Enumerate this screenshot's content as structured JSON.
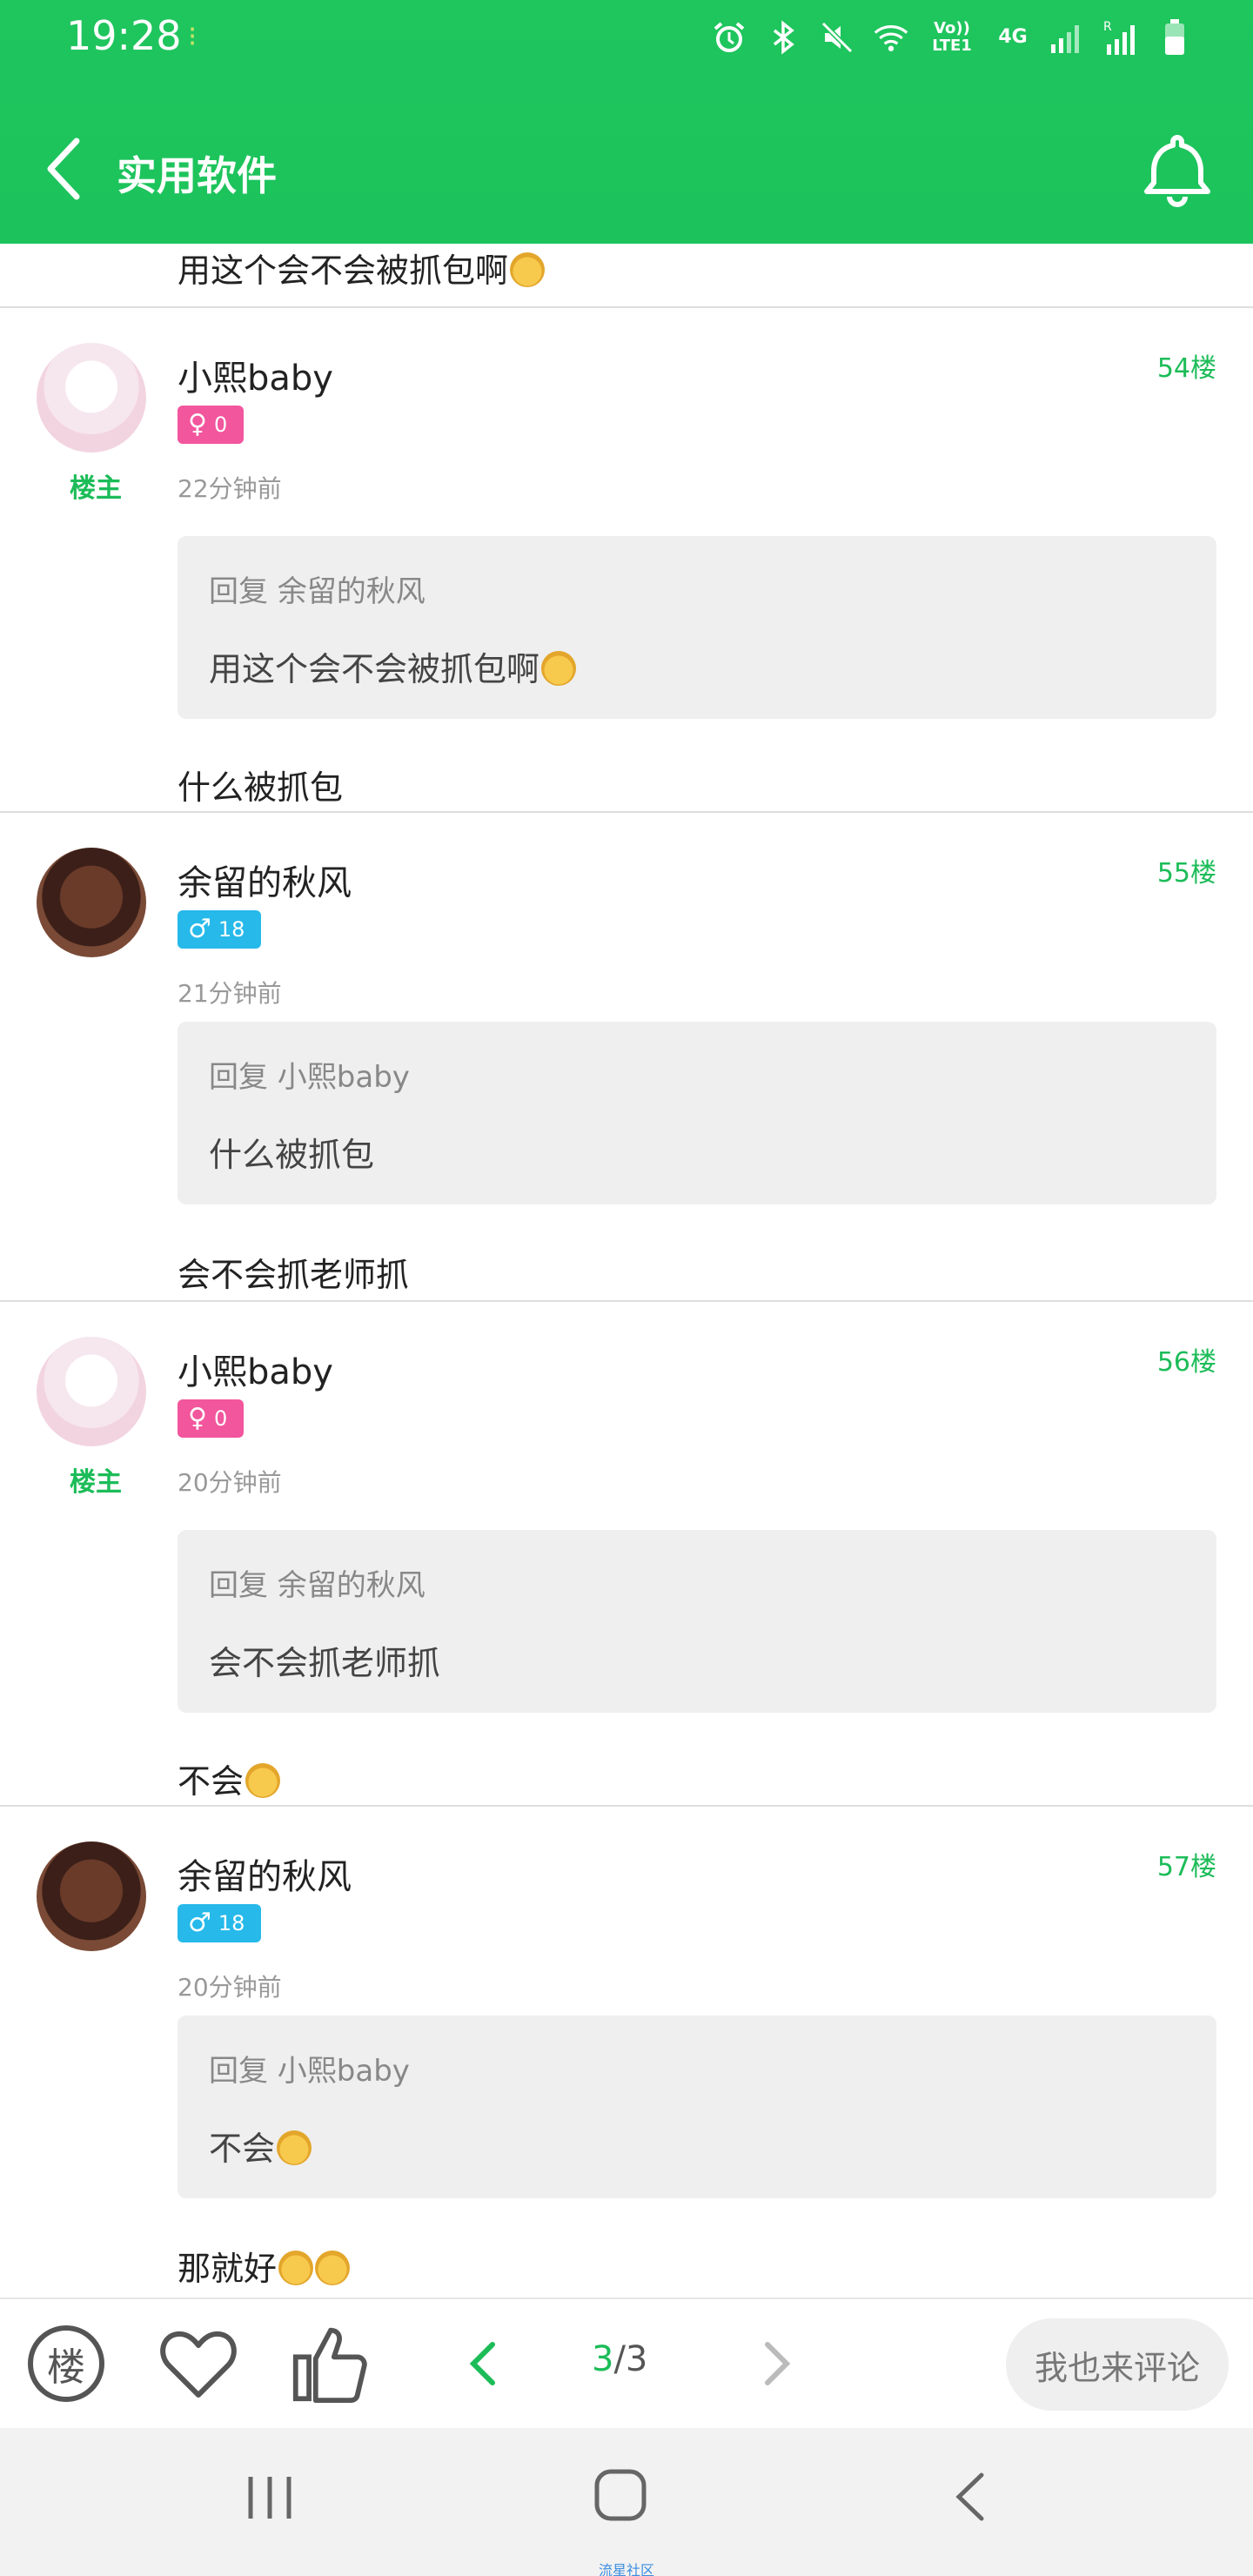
{
  "status_bar": {
    "time": "19:28",
    "network_label": "Vo))\nLTE1",
    "net_type": "4G",
    "roaming": "R"
  },
  "nav": {
    "title": "实用软件"
  },
  "feed": {
    "top_snippet": "用这个会不会被抓包啊",
    "posts": [
      {
        "username": "小熙baby",
        "owner_tag": "楼主",
        "gender_symbol": "♀",
        "level": "0",
        "time": "22分钟前",
        "floor": "54楼",
        "quote_head": "回复 余留的秋风",
        "quote_text": "用这个会不会被抓包啊",
        "reply": "什么被抓包"
      },
      {
        "username": "余留的秋风",
        "owner_tag": "",
        "gender_symbol": "♂",
        "level": "18",
        "time": "21分钟前",
        "floor": "55楼",
        "quote_head": "回复 小熙baby",
        "quote_text": "什么被抓包",
        "reply": "会不会抓老师抓"
      },
      {
        "username": "小熙baby",
        "owner_tag": "楼主",
        "gender_symbol": "♀",
        "level": "0",
        "time": "20分钟前",
        "floor": "56楼",
        "quote_head": "回复 余留的秋风",
        "quote_text": "会不会抓老师抓",
        "reply": "不会"
      },
      {
        "username": "余留的秋风",
        "owner_tag": "",
        "gender_symbol": "♂",
        "level": "18",
        "time": "20分钟前",
        "floor": "57楼",
        "quote_head": "回复 小熙baby",
        "quote_text": "不会",
        "reply": "那就好"
      }
    ]
  },
  "actions": {
    "floor_label": "楼",
    "page_current": "3",
    "page_total": "/3",
    "comment_label": "我也来评论"
  },
  "watermark": "流星社区",
  "colors": {
    "brand_green": "#1cc35c",
    "female": "#f2569d",
    "male": "#26b9ea"
  }
}
